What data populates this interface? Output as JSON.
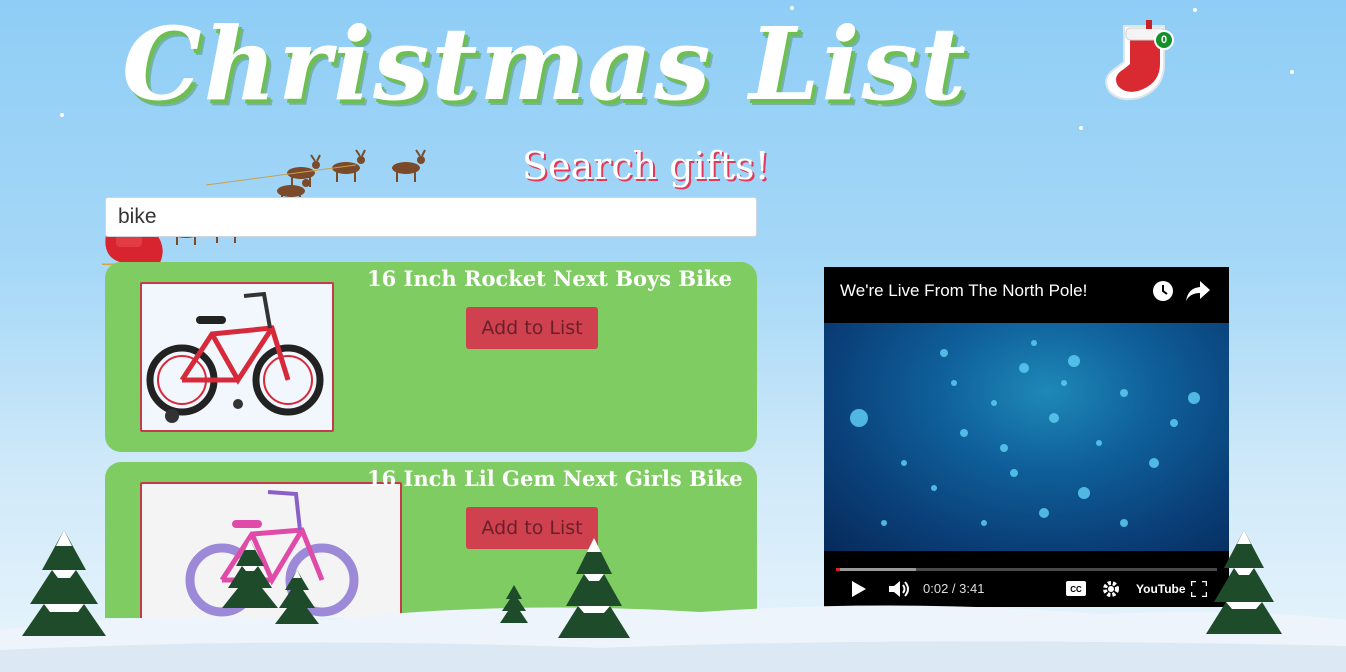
{
  "header": {
    "title": "Christmas List",
    "subtitle": "Search gifts!",
    "stocking_count": "0"
  },
  "search": {
    "value": "bike"
  },
  "results": [
    {
      "name": "16 Inch Rocket Next Boys Bike",
      "button_label": "Add to List"
    },
    {
      "name": "16 Inch Lil Gem Next Girls Bike",
      "button_label": "Add to List"
    }
  ],
  "video": {
    "title": "We're Live From The North Pole!",
    "time": "0:02 / 3:41",
    "progress_fraction": 0.01,
    "loaded_fraction": 0.21,
    "logo_text": "YouTube",
    "icons": [
      "watch-later-icon",
      "share-icon",
      "play-icon",
      "volume-icon",
      "captions-icon",
      "settings-icon",
      "youtube-logo-icon",
      "fullscreen-icon"
    ]
  },
  "colors": {
    "card_green": "#7fcc62",
    "button_red": "#d0414f",
    "title_shadow_green": "#6cbf50",
    "sky_blue": "#8fcdf6"
  }
}
